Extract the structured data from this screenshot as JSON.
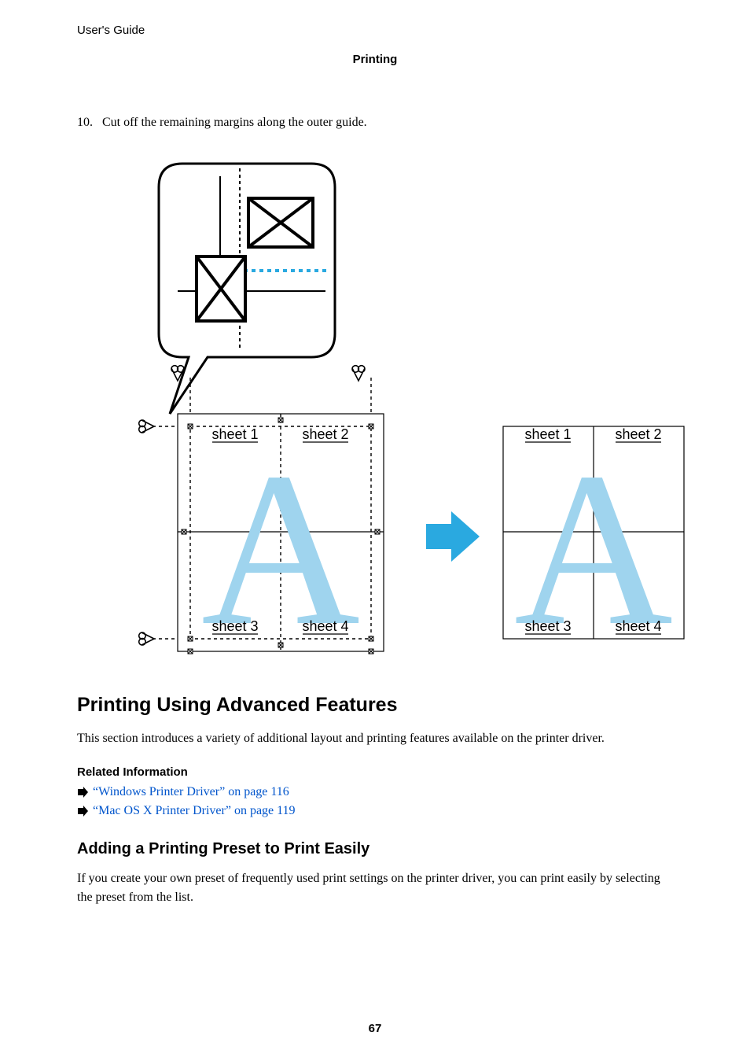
{
  "header": {
    "guide": "User's Guide",
    "section": "Printing"
  },
  "step": {
    "number": "10.",
    "text": "Cut off the remaining margins along the outer guide."
  },
  "figure": {
    "left": {
      "s1": "sheet 1",
      "s2": "sheet 2",
      "s3": "sheet 3",
      "s4": "sheet 4"
    },
    "right": {
      "s1": "sheet 1",
      "s2": "sheet 2",
      "s3": "sheet 3",
      "s4": "sheet 4"
    }
  },
  "features": {
    "heading": "Printing Using Advanced Features",
    "intro": "This section introduces a variety of additional layout and printing features available on the printer driver."
  },
  "related": {
    "heading": "Related Information",
    "items": [
      "“Windows Printer Driver” on page 116",
      "“Mac OS X Printer Driver” on page 119"
    ]
  },
  "preset": {
    "heading": "Adding a Printing Preset to Print Easily",
    "body": "If you create your own preset of frequently used print settings on the printer driver, you can print easily by selecting the preset from the list."
  },
  "pageNumber": "67"
}
